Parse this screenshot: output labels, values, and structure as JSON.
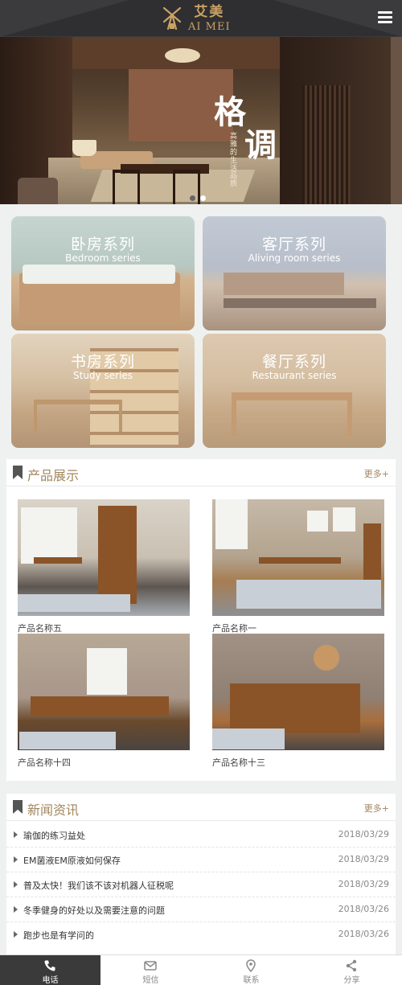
{
  "brand": {
    "name_cn": "艾美",
    "name_en": "AI MEI"
  },
  "banner": {
    "headline_1": "格",
    "headline_2": "调",
    "subtitle": "高雅的生活品质",
    "slides": 2,
    "active_slide": 2
  },
  "categories": [
    {
      "cn": "卧房系列",
      "en": "Bedroom series"
    },
    {
      "cn": "客厅系列",
      "en": "Aliving room series"
    },
    {
      "cn": "书房系列",
      "en": "Study series"
    },
    {
      "cn": "餐厅系列",
      "en": "Restaurant series"
    }
  ],
  "products": {
    "title": "产品展示",
    "more": "更多+",
    "items": [
      {
        "name": "产品名称五"
      },
      {
        "name": "产品名称一"
      },
      {
        "name": "产品名称十四"
      },
      {
        "name": "产品名称十三"
      }
    ]
  },
  "news": {
    "title": "新闻资讯",
    "more": "更多+",
    "items": [
      {
        "title": "瑜伽的练习益处",
        "date": "2018/03/29"
      },
      {
        "title": "EM菌液EM原液如何保存",
        "date": "2018/03/29"
      },
      {
        "title": "普及太快！我们该不该对机器人征税呢",
        "date": "2018/03/29"
      },
      {
        "title": "冬季健身的好处以及需要注意的问题",
        "date": "2018/03/26"
      },
      {
        "title": "跑步也是有学问的",
        "date": "2018/03/26"
      }
    ]
  },
  "bottom_nav": [
    {
      "label": "电话",
      "icon": "phone-icon",
      "active": true
    },
    {
      "label": "短信",
      "icon": "mail-icon",
      "active": false
    },
    {
      "label": "联系",
      "icon": "location-pin-icon",
      "active": false
    },
    {
      "label": "分享",
      "icon": "share-icon",
      "active": false
    }
  ],
  "colors": {
    "accent": "#a2865e",
    "header_bg": "#2f2f31",
    "logo": "#c9a264"
  }
}
